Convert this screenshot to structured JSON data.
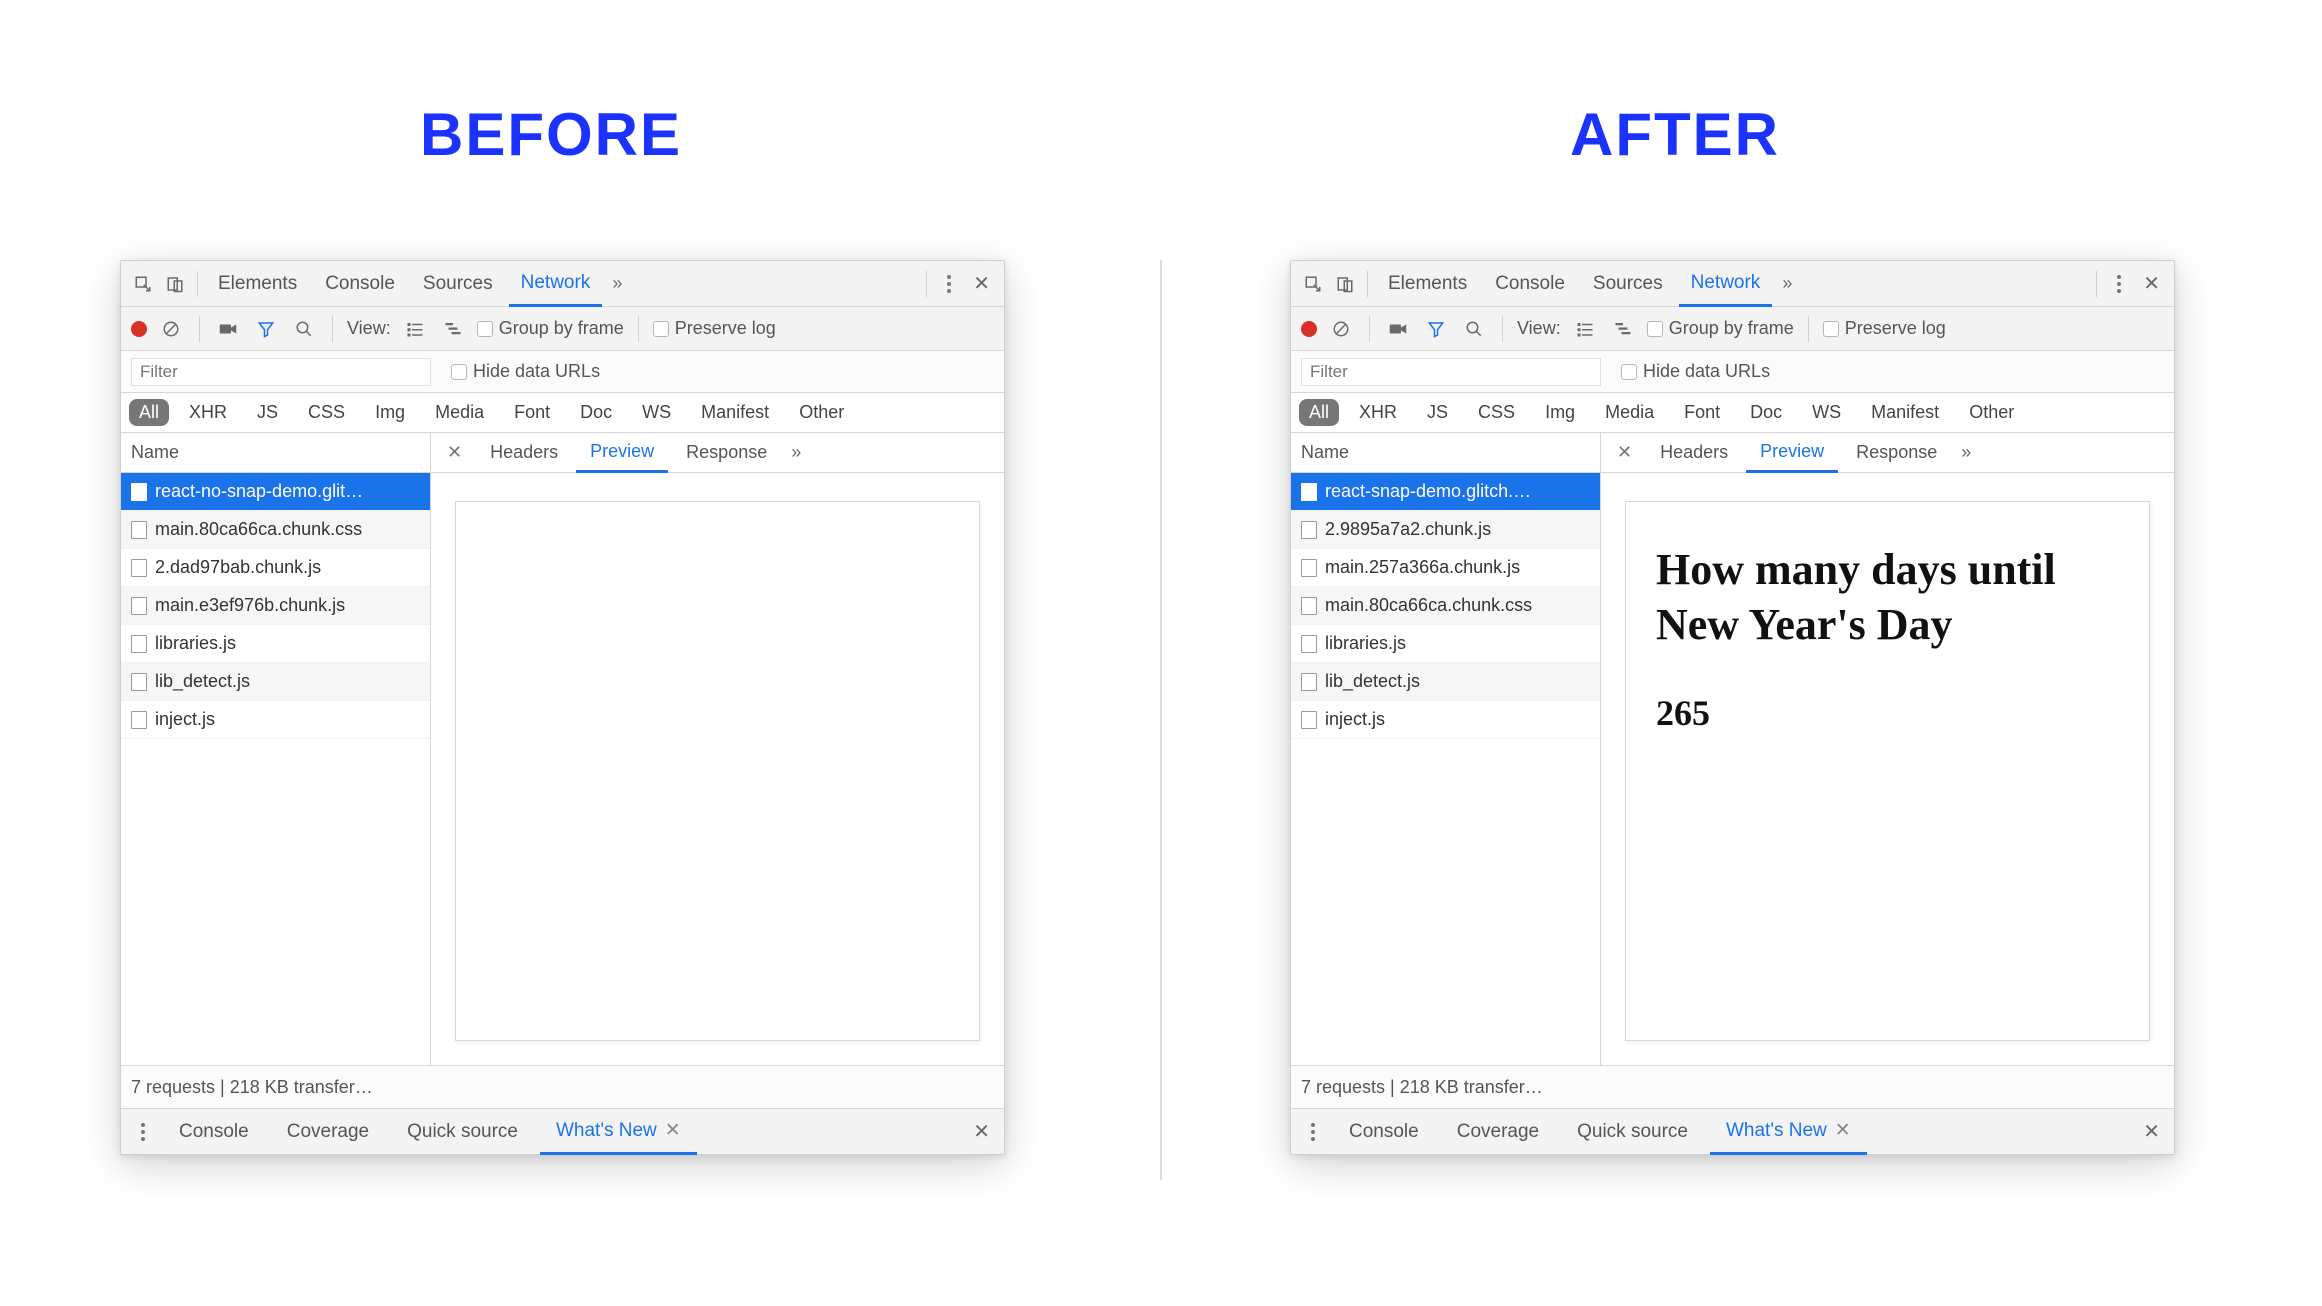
{
  "headings": {
    "before": "BEFORE",
    "after": "AFTER"
  },
  "topTabs": {
    "items": [
      "Elements",
      "Console",
      "Sources",
      "Network"
    ],
    "selected": "Network"
  },
  "toolbar": {
    "viewLabel": "View:",
    "groupByFrame": "Group by frame",
    "preserveLog": "Preserve log"
  },
  "filter": {
    "placeholder": "Filter",
    "hideDataUrls": "Hide data URLs"
  },
  "typeFilters": [
    "All",
    "XHR",
    "JS",
    "CSS",
    "Img",
    "Media",
    "Font",
    "Doc",
    "WS",
    "Manifest",
    "Other"
  ],
  "listHeader": "Name",
  "detailTabs": {
    "items": [
      "Headers",
      "Preview",
      "Response"
    ],
    "selected": "Preview"
  },
  "status": "7 requests | 218 KB transfer…",
  "drawerTabs": {
    "items": [
      "Console",
      "Coverage",
      "Quick source",
      "What's New"
    ],
    "selected": "What's New"
  },
  "panels": {
    "before": {
      "requests": [
        "react-no-snap-demo.glit…",
        "main.80ca66ca.chunk.css",
        "2.dad97bab.chunk.js",
        "main.e3ef976b.chunk.js",
        "libraries.js",
        "lib_detect.js",
        "inject.js"
      ],
      "selectedIndex": 0,
      "preview": {
        "title": "",
        "number": ""
      }
    },
    "after": {
      "requests": [
        "react-snap-demo.glitch.…",
        "2.9895a7a2.chunk.js",
        "main.257a366a.chunk.js",
        "main.80ca66ca.chunk.css",
        "libraries.js",
        "lib_detect.js",
        "inject.js"
      ],
      "selectedIndex": 0,
      "preview": {
        "title": "How many days until New Year's Day",
        "number": "265"
      }
    }
  }
}
